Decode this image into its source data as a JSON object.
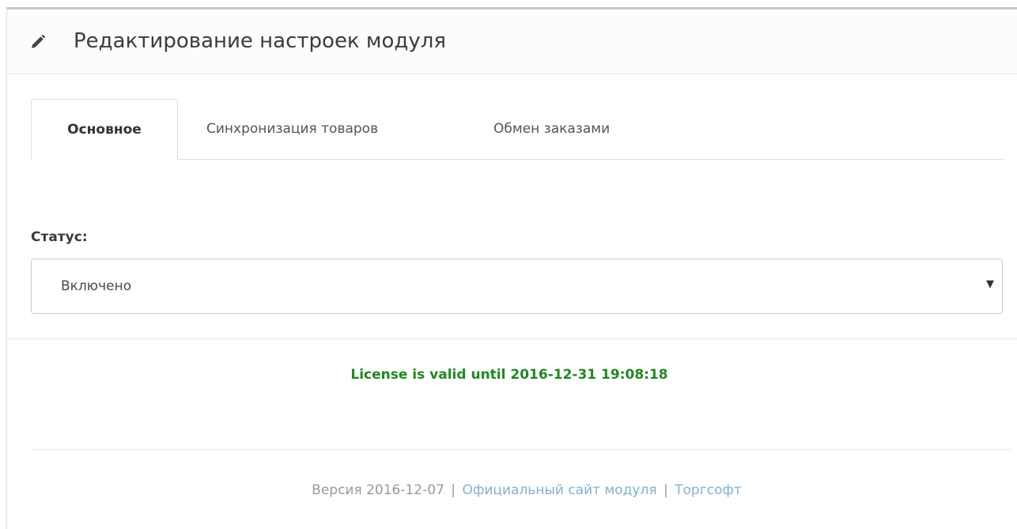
{
  "header": {
    "title": "Редактирование настроек модуля",
    "icon": "pencil-icon"
  },
  "tabs": [
    {
      "label": "Основное",
      "active": true
    },
    {
      "label": "Синхронизация товаров",
      "active": false
    },
    {
      "label": "Обмен заказами",
      "active": false
    }
  ],
  "form": {
    "status_label": "Статус:",
    "status_value": "Включено",
    "arrow": "▼"
  },
  "license": {
    "text": "License is valid until 2016-12-31 19:08:18",
    "color": "#1e8a1e"
  },
  "footer": {
    "version": "Версия 2016-12-07",
    "separator": "|",
    "official_site_link": "Официальный сайт модуля",
    "torgsoft_link": "Торгсофт",
    "link_color": "#7fb3d5"
  }
}
